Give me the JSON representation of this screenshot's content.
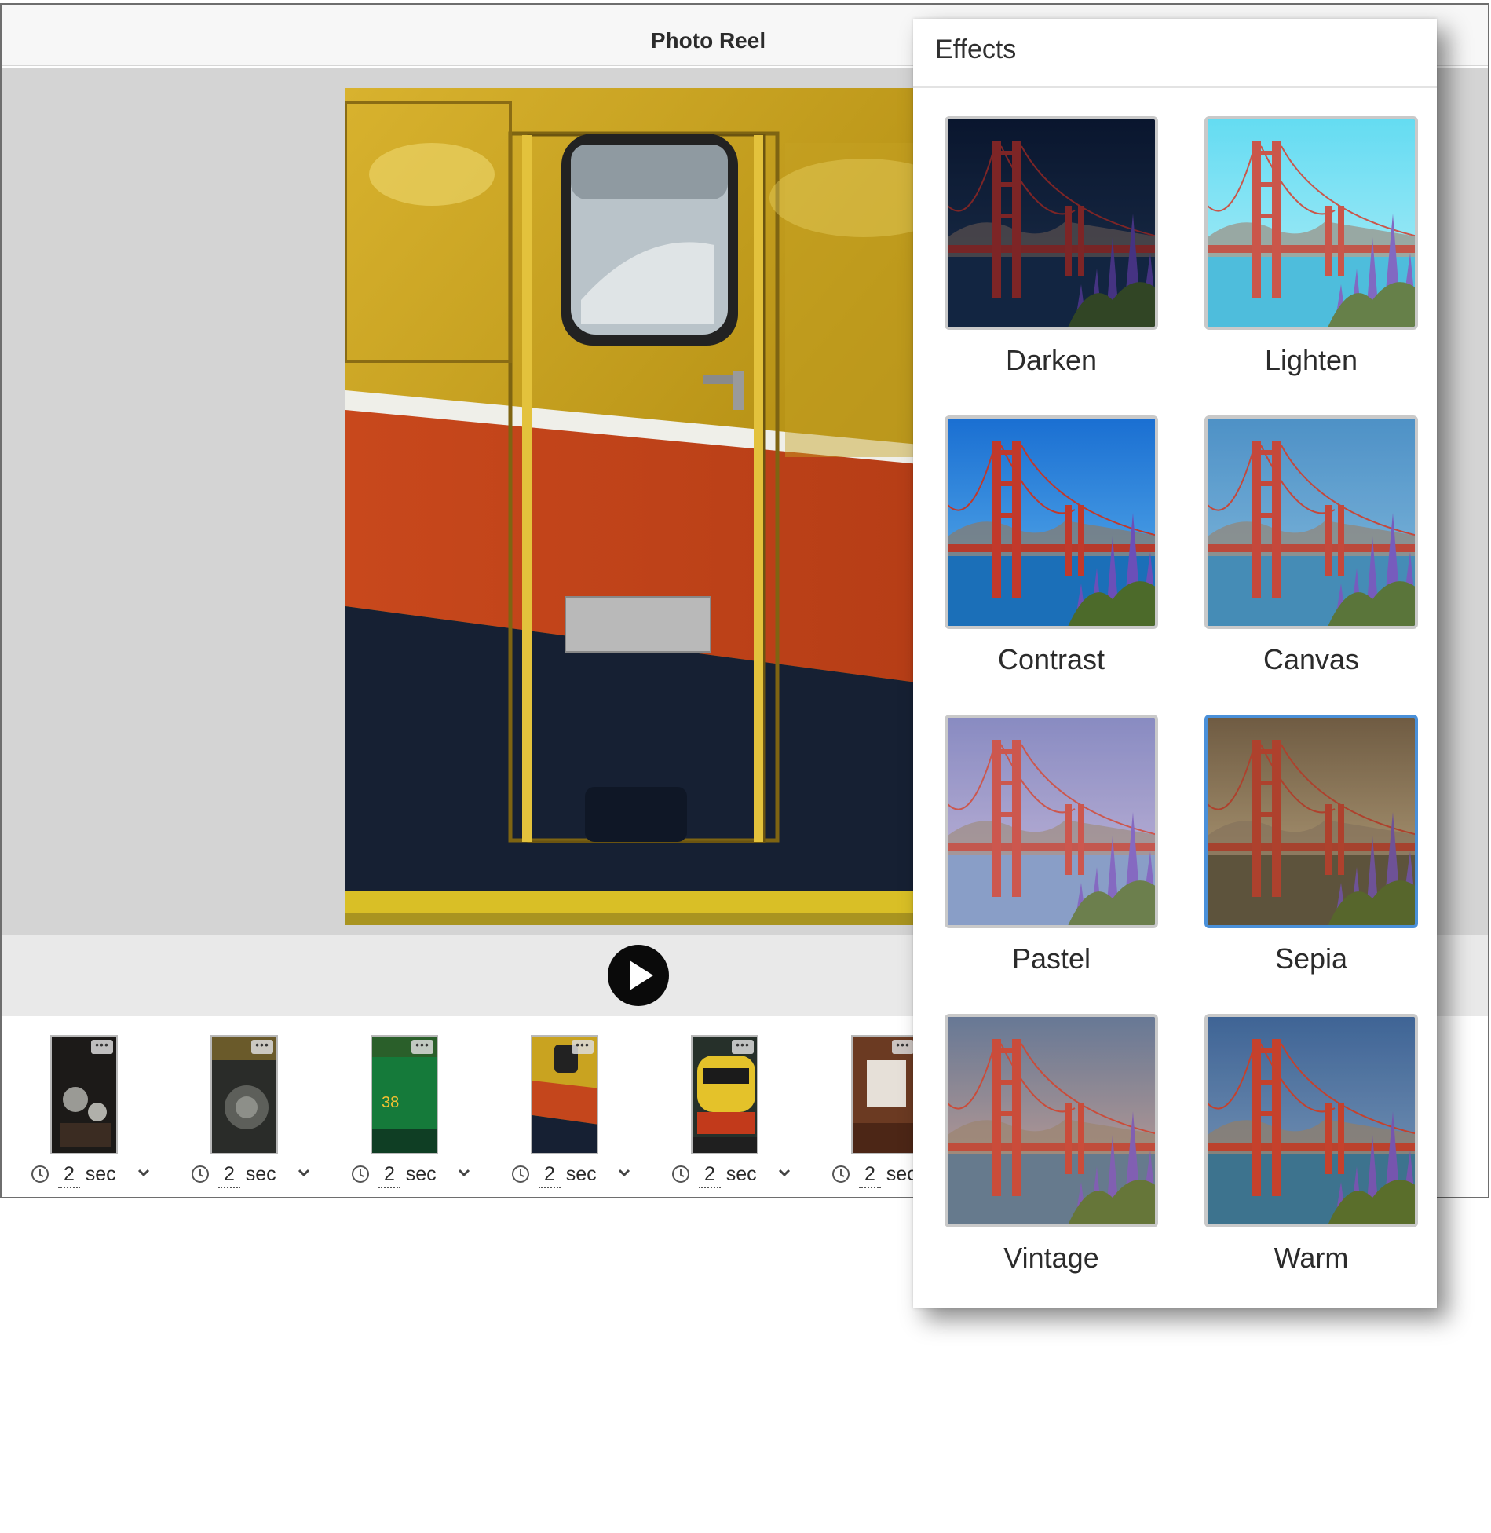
{
  "app": {
    "title": "Photo Reel"
  },
  "filmstrip": {
    "slides": [
      {
        "duration": "2",
        "unit": "sec",
        "theme": "gears"
      },
      {
        "duration": "2",
        "unit": "sec",
        "theme": "engine"
      },
      {
        "duration": "2",
        "unit": "sec",
        "theme": "green-train"
      },
      {
        "duration": "2",
        "unit": "sec",
        "theme": "yellow-door"
      },
      {
        "duration": "2",
        "unit": "sec",
        "theme": "yellow-train"
      },
      {
        "duration": "2",
        "unit": "sec",
        "theme": "interior"
      }
    ],
    "menu_glyph": "•••"
  },
  "effects": {
    "title": "Effects",
    "selected": "Sepia",
    "items": [
      {
        "label": "Darken",
        "sky_top": "#0f2238",
        "sky_bottom": "#2d4b66",
        "water": "#1c3a55",
        "tint": "rgba(0,0,30,0.35)"
      },
      {
        "label": "Lighten",
        "sky_top": "#4ad6f0",
        "sky_bottom": "#a9ecf6",
        "water": "#2fb2d6",
        "tint": "rgba(255,255,255,0.15)"
      },
      {
        "label": "Contrast",
        "sky_top": "#1a6fd2",
        "sky_bottom": "#62b6ee",
        "water": "#1b6fb8",
        "tint": "rgba(0,0,0,0)"
      },
      {
        "label": "Canvas",
        "sky_top": "#3f88c2",
        "sky_bottom": "#7fb9dd",
        "water": "#3683b0",
        "tint": "rgba(255,255,255,0.08)"
      },
      {
        "label": "Pastel",
        "sky_top": "#6f78b8",
        "sky_bottom": "#c0b4d8",
        "water": "#6f8fbf",
        "tint": "rgba(255,230,240,0.18)"
      },
      {
        "label": "Sepia",
        "sky_top": "#6d5c48",
        "sky_bottom": "#d5c39d",
        "water": "#54513f",
        "tint": "rgba(120,90,50,0.25)"
      },
      {
        "label": "Vintage",
        "sky_top": "#4d6d96",
        "sky_bottom": "#d1a394",
        "water": "#4c6f8c",
        "tint": "rgba(255,190,150,0.15)"
      },
      {
        "label": "Warm",
        "sky_top": "#2f5f9d",
        "sky_bottom": "#7aa0c9",
        "water": "#2d6f95",
        "tint": "rgba(255,160,60,0.08)"
      }
    ]
  },
  "colors": {
    "selection": "#4a90d9",
    "train_yellow": "#c9a320",
    "train_orange": "#c4461c",
    "train_navy": "#162033"
  }
}
